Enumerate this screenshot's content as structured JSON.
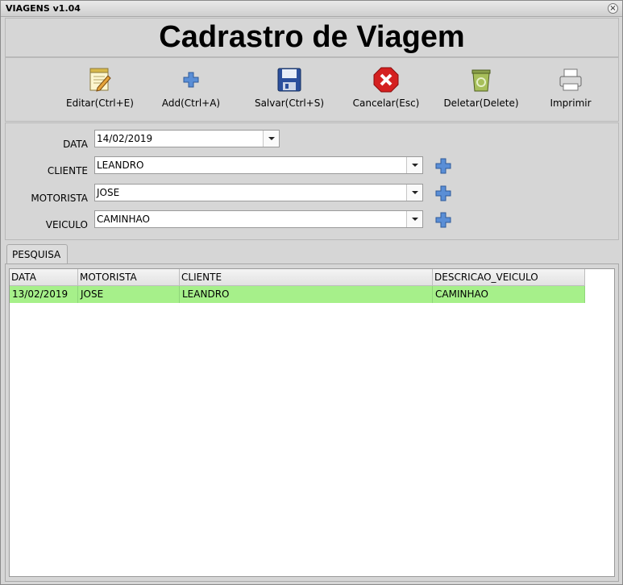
{
  "window": {
    "title": "VIAGENS v1.04",
    "close_glyph": "×"
  },
  "header": {
    "title": "Cadrastro de Viagem"
  },
  "toolbar": {
    "edit_label": "Editar(Ctrl+E)",
    "add_label": "Add(Ctrl+A)",
    "save_label": "Salvar(Ctrl+S)",
    "cancel_label": "Cancelar(Esc)",
    "delete_label": "Deletar(Delete)",
    "print_label": "Imprimir"
  },
  "form": {
    "data_label": "DATA",
    "data_value": "14/02/2019",
    "cliente_label": "CLIENTE",
    "cliente_value": "LEANDRO",
    "motorista_label": "MOTORISTA",
    "motorista_value": "JOSE",
    "veiculo_label": "VEICULO",
    "veiculo_value": "CAMINHAO"
  },
  "tabs": [
    {
      "label": "PESQUISA"
    }
  ],
  "table": {
    "columns": [
      "DATA",
      "MOTORISTA",
      "CLIENTE",
      "DESCRICAO_VEICULO"
    ],
    "rows": [
      [
        "13/02/2019",
        "JOSE",
        "LEANDRO",
        "CAMINHAO"
      ]
    ]
  },
  "colors": {
    "selected_row": "#a6f08a",
    "plus_icon": "#3d6fb8",
    "cancel_icon": "#d42020"
  },
  "icons": {
    "edit": "notepad-pencil-icon",
    "add": "plus-icon",
    "save": "floppy-disk-icon",
    "cancel": "red-x-icon",
    "delete": "recycle-bin-icon",
    "print": "printer-icon"
  }
}
